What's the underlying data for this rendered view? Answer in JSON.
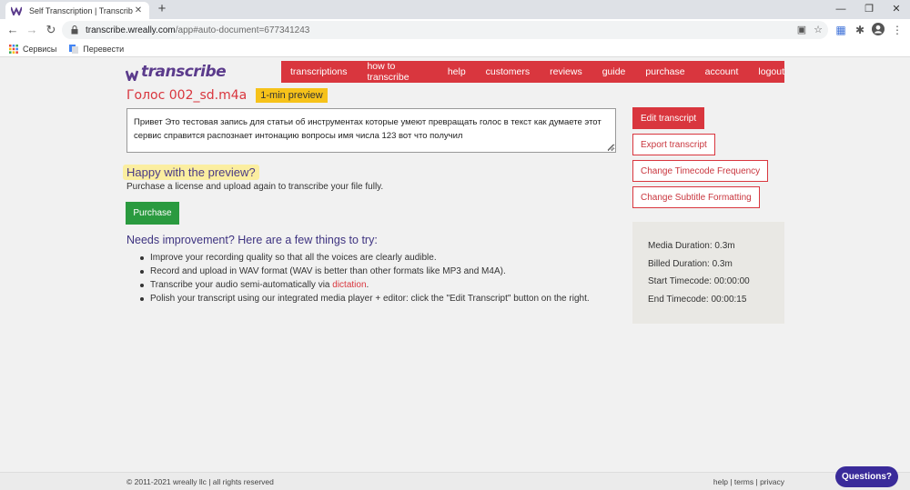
{
  "browser": {
    "tab_title": "Self Transcription | Transcribe",
    "tab_close": "✕",
    "new_tab": "+",
    "url_host": "transcribe.wreally.com",
    "url_path": "/app#auto-document=677341243",
    "bookmarks": [
      {
        "label": "Сервисы",
        "icon": "apps-grid-icon"
      },
      {
        "label": "Перевести",
        "icon": "google-translate-icon"
      }
    ]
  },
  "site": {
    "logo_text": "transcribe",
    "nav": [
      "transcriptions",
      "how to transcribe",
      "help",
      "customers",
      "reviews",
      "guide",
      "purchase",
      "account",
      "logout"
    ]
  },
  "document": {
    "file_name": "Голос 002_sd.m4a",
    "preview_badge": "1-min preview",
    "transcript": "Привет Это тестовая запись для статьи об инструментах которые умеют превращать голос в текст как думаете этот сервис справится распознает интонацию вопросы имя числа 123 вот что получил"
  },
  "happy": {
    "title": "Happy with the preview?",
    "subtitle": "Purchase a license and upload again to transcribe your file fully.",
    "purchase_label": "Purchase"
  },
  "improve": {
    "title": "Needs improvement? Here are a few things to try:",
    "tips": [
      "Improve your recording quality so that all the voices are clearly audible.",
      "Record and upload in WAV format (WAV is better than other formats like MP3 and M4A)."
    ],
    "tip3_prefix": "Transcribe your audio semi-automatically via ",
    "tip3_link": "dictation",
    "tip3_suffix": ".",
    "tip4": "Polish your transcript using our integrated media player + editor: click the \"Edit Transcript\" button on the right."
  },
  "actions": {
    "edit": "Edit transcript",
    "export": "Export transcript",
    "timecode": "Change Timecode Frequency",
    "subtitle": "Change Subtitle Formatting"
  },
  "info": {
    "media_duration": "Media Duration: 0.3m",
    "billed_duration": "Billed Duration: 0.3m",
    "start_timecode": "Start Timecode: 00:00:00",
    "end_timecode": "End Timecode: 00:00:15"
  },
  "footer": {
    "copyright": "© 2011-2021 wreally llc | all rights reserved",
    "help": "help",
    "terms": "terms",
    "privacy": "privacy",
    "sep": " | "
  },
  "questions_label": "Questions?",
  "colors": {
    "brand_red": "#d9363e",
    "brand_purple": "#5b3b8c",
    "purchase_green": "#2a9a3f",
    "badge_yellow": "#f6c21a"
  }
}
